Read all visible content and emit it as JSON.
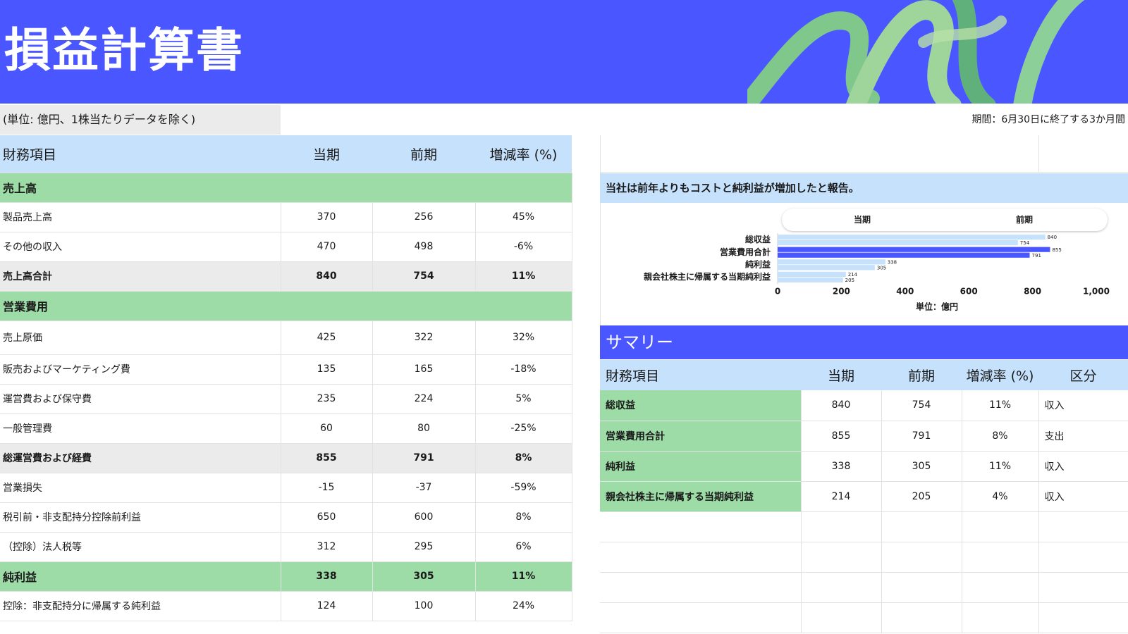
{
  "header": {
    "title": "損益計算書"
  },
  "unit_note": "(単位: 億円、1株当たりデータを除く)",
  "period_note": "期間：6月30日に終了する3か月間",
  "main_table": {
    "headers": [
      "財務項目",
      "当期",
      "前期",
      "増減率 (%)"
    ],
    "rows": [
      {
        "type": "section",
        "label": "売上高"
      },
      {
        "type": "row",
        "label": "製品売上高",
        "cur": "370",
        "prev": "256",
        "pct": "45%"
      },
      {
        "type": "row",
        "label": "その他の収入",
        "cur": "470",
        "prev": "498",
        "pct": "-6%"
      },
      {
        "type": "subtotal",
        "label": "売上高合計",
        "cur": "840",
        "prev": "754",
        "pct": "11%"
      },
      {
        "type": "section",
        "label": "営業費用"
      },
      {
        "type": "row",
        "label": "売上原価",
        "cur": "425",
        "prev": "322",
        "pct": "32%"
      },
      {
        "type": "row",
        "label": "販売およびマーケティング費",
        "cur": "135",
        "prev": "165",
        "pct": "-18%"
      },
      {
        "type": "row",
        "label": "運営費および保守費",
        "cur": "235",
        "prev": "224",
        "pct": "5%"
      },
      {
        "type": "row",
        "label": "一般管理費",
        "cur": "60",
        "prev": "80",
        "pct": "-25%"
      },
      {
        "type": "subtotal",
        "label": "総運営費および経費",
        "cur": "855",
        "prev": "791",
        "pct": "8%"
      },
      {
        "type": "row",
        "label": "営業損失",
        "cur": "-15",
        "prev": "-37",
        "pct": "-59%"
      },
      {
        "type": "row",
        "label": "税引前・非支配持分控除前利益",
        "cur": "650",
        "prev": "600",
        "pct": "8%"
      },
      {
        "type": "row",
        "label": "（控除）法人税等",
        "cur": "312",
        "prev": "295",
        "pct": "6%"
      },
      {
        "type": "net",
        "label": "純利益",
        "cur": "338",
        "prev": "305",
        "pct": "11%"
      },
      {
        "type": "row",
        "label": "控除：非支配持分に帰属する純利益",
        "cur": "124",
        "prev": "100",
        "pct": "24%"
      }
    ]
  },
  "chart_header": "当社は前年よりもコストと純利益が増加したと報告。",
  "chart_data": {
    "type": "bar",
    "orientation": "horizontal",
    "categories": [
      "総収益",
      "営業費用合計",
      "純利益",
      "親会社株主に帰属する当期純利益"
    ],
    "series": [
      {
        "name": "当期",
        "values": [
          840,
          855,
          338,
          214
        ]
      },
      {
        "name": "前期",
        "values": [
          754,
          791,
          305,
          205
        ]
      }
    ],
    "xlabel": "単位：億円",
    "xlim": [
      0,
      1000
    ],
    "ticks": [
      "0",
      "200",
      "400",
      "600",
      "800",
      "1,000"
    ],
    "legend_position": "top",
    "colors": {
      "営業費用合計": "#4a56ff",
      "default": "#c5e1fc"
    }
  },
  "summary": {
    "title": "サマリー",
    "headers": [
      "財務項目",
      "当期",
      "前期",
      "増減率 (%)",
      "区分"
    ],
    "rows": [
      {
        "label": "総収益",
        "cur": "840",
        "prev": "754",
        "pct": "11%",
        "cat": "収入"
      },
      {
        "label": "営業費用合計",
        "cur": "855",
        "prev": "791",
        "pct": "8%",
        "cat": "支出"
      },
      {
        "label": "純利益",
        "cur": "338",
        "prev": "305",
        "pct": "11%",
        "cat": "収入"
      },
      {
        "label": "親会社株主に帰属する当期純利益",
        "cur": "214",
        "prev": "205",
        "pct": "4%",
        "cat": "収入"
      }
    ]
  },
  "colors": {
    "brand": "#4a56ff",
    "header_blue": "#c5e1fc",
    "section_green": "#9ddca6",
    "subtotal_gray": "#ebebeb"
  }
}
